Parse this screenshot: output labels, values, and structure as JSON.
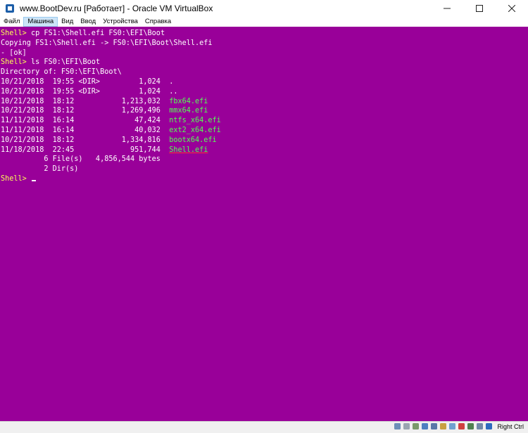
{
  "window": {
    "title": "www.BootDev.ru [Работает] - Oracle VM VirtualBox"
  },
  "menu": [
    "Файл",
    "Машина",
    "Вид",
    "Ввод",
    "Устройства",
    "Справка"
  ],
  "console": {
    "lines": [
      [
        {
          "t": "Shell> ",
          "c": "prompt"
        },
        {
          "t": "cp FS1:\\Shell.efi FS0:\\EFI\\Boot",
          "c": "white"
        }
      ],
      [
        {
          "t": "Copying FS1:\\Shell.efi -> FS0:\\EFI\\Boot\\Shell.efi",
          "c": "white"
        }
      ],
      [
        {
          "t": "- [ok]",
          "c": "white"
        }
      ],
      [
        {
          "t": "Shell> ",
          "c": "prompt"
        },
        {
          "t": "ls FS0:\\EFI\\Boot",
          "c": "white"
        }
      ],
      [
        {
          "t": "Directory of: FS0:\\EFI\\Boot\\",
          "c": "white"
        }
      ],
      [
        {
          "t": "10/21/2018  19:55 <DIR>         1,024  .",
          "c": "white"
        }
      ],
      [
        {
          "t": "10/21/2018  19:55 <DIR>         1,024  ..",
          "c": "white"
        }
      ],
      [
        {
          "t": "10/21/2018  18:12           1,213,032  ",
          "c": "white"
        },
        {
          "t": "fbx64.efi",
          "c": "green"
        }
      ],
      [
        {
          "t": "10/21/2018  18:12           1,269,496  ",
          "c": "white"
        },
        {
          "t": "mmx64.efi",
          "c": "green"
        }
      ],
      [
        {
          "t": "11/11/2018  16:14              47,424  ",
          "c": "white"
        },
        {
          "t": "ntfs_x64.efi",
          "c": "green"
        }
      ],
      [
        {
          "t": "11/11/2018  16:14              40,032  ",
          "c": "white"
        },
        {
          "t": "ext2_x64.efi",
          "c": "green"
        }
      ],
      [
        {
          "t": "10/21/2018  18:12           1,334,816  ",
          "c": "white"
        },
        {
          "t": "bootx64.efi",
          "c": "green"
        }
      ],
      [
        {
          "t": "11/18/2018  22:45             951,744  ",
          "c": "white"
        },
        {
          "t": "Shell.efi",
          "c": "green underline"
        }
      ],
      [
        {
          "t": "          6 File(s)   4,856,544 bytes",
          "c": "white"
        }
      ],
      [
        {
          "t": "          2 Dir(s)",
          "c": "white"
        }
      ],
      [
        {
          "t": "Shell> ",
          "c": "prompt"
        }
      ]
    ]
  },
  "statusbar": {
    "icons": [
      "hard-disk-icon",
      "optical-drive-icon",
      "audio-icon",
      "network-icon",
      "usb-icon",
      "shared-folder-icon",
      "display-icon",
      "video-capture-icon",
      "cpu-icon",
      "mouse-integration-icon",
      "host-key-arrow-icon"
    ],
    "host_key": "Right Ctrl"
  },
  "colors": {
    "console_bg": "#990099",
    "prompt": "#ffff55",
    "file": "#55ff55",
    "text": "#ffffff"
  }
}
